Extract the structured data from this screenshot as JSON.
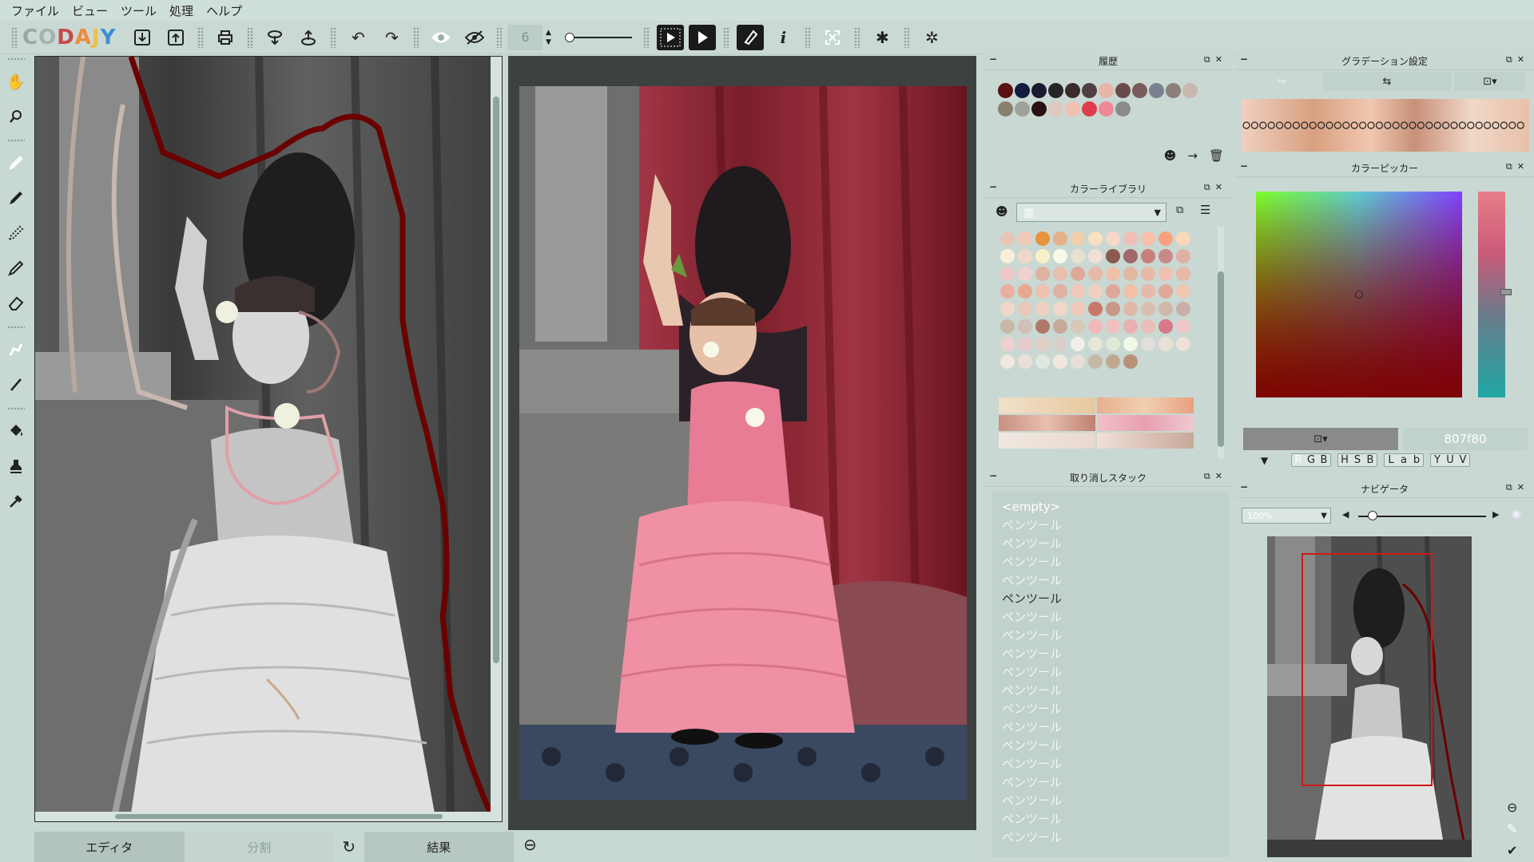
{
  "menu": [
    "ファイル",
    "ビュー",
    "ツール",
    "処理",
    "ヘルプ"
  ],
  "app": {
    "logo_letters": [
      "C",
      "O",
      "D",
      "A",
      "J",
      "Y"
    ],
    "logo_colors": [
      "#9aa6a4",
      "#a6b1af",
      "#c64a4a",
      "#ed8c3c",
      "#e8c14a",
      "#3c8fd6"
    ]
  },
  "toolbar": {
    "brush_size": "6"
  },
  "icons": {
    "import": "⇩",
    "export": "⇧",
    "print": "⎙",
    "undo": "↶",
    "redo": "↷",
    "eye": "◉",
    "info": "i",
    "star": "✱",
    "bug": "✲"
  },
  "tabs": {
    "editor": "エディタ",
    "split": "分割",
    "result": "結果"
  },
  "panels": {
    "history": {
      "title": "履歴"
    },
    "library": {
      "title": "カラーライブラリ",
      "combo_value": "茵"
    },
    "undo": {
      "title": "取り消しスタック",
      "items": [
        "<empty>",
        "ペンツール",
        "ペンツール",
        "ペンツール",
        "ペンツール",
        "ペンツール",
        "ペンツール",
        "ペンツール",
        "ペンツール",
        "ペンツール",
        "ペンツール",
        "ペンツール",
        "ペンツール",
        "ペンツール",
        "ペンツール",
        "ペンツール",
        "ペンツール",
        "ペンツール",
        "ペンツール"
      ],
      "current_index": 5
    },
    "gradient": {
      "title": "グラデーション設定"
    },
    "picker": {
      "title": "カラーピッカー",
      "hex_value": "807f80",
      "modes": [
        [
          "R",
          "G",
          "B"
        ],
        [
          "H",
          "S",
          "B"
        ],
        [
          "L",
          "a",
          "b"
        ],
        [
          "Y",
          "U",
          "V"
        ]
      ]
    },
    "navigator": {
      "title": "ナビゲータ",
      "zoom": "100%"
    }
  },
  "history_colors": [
    "#5a1010",
    "#101c40",
    "#1a1a30",
    "#262626",
    "#3a2a2a",
    "#4e4040",
    "#e8b4a8",
    "#6a4a4a",
    "#7a5a5a",
    "#7a8090",
    "#8a7f7a",
    "#c8b8b0",
    "#8a8070",
    "#a0a09a",
    "#2a1010",
    "#e0c8c0",
    "#f0c0b0",
    "#e03c4c",
    "#f08898",
    "#8a8a8a"
  ],
  "library_colors": [
    "#e8c4b4",
    "#f0c8b8",
    "#e8943c",
    "#e8b088",
    "#f0d0a8",
    "#f8e0c0",
    "#f8d8c8",
    "#f0c0b8",
    "#f8c0a8",
    "#f8a080",
    "#f8d8b8",
    "#f8f0d8",
    "#f0d8c8",
    "#f8f0c8",
    "#f8f8e8",
    "#e8e0d0",
    "#f0e0d8",
    "#8a5a50",
    "#a0686a",
    "#c88078",
    "#c88888",
    "#e0b0a8",
    "#f0c8c8",
    "#f0d0d0",
    "#e0b0a0",
    "#e8c0b0",
    "#e0a898",
    "#e8b8a8",
    "#f0c0a8",
    "#e0b8a0",
    "#e8b8a8",
    "#f0c0b0",
    "#e8b8a8",
    "#e8b0a0",
    "#e8a890",
    "#f0c0b0",
    "#e0b0a0",
    "#f0c8b8",
    "#f0d0c0",
    "#e0a898",
    "#f0c0a8",
    "#e8b8a8",
    "#e0a898",
    "#f0c8b0",
    "#f0d8c8",
    "#e8c8b8",
    "#f0d0c0",
    "#f0d8c8",
    "#f0c8b8",
    "#c87868",
    "#c89888",
    "#e0b8a8",
    "#d8c0b0",
    "#d0b8a8",
    "#c8b0a8",
    "#c8b8a8",
    "#d0c0b8",
    "#b07868",
    "#c8a898",
    "#d8c8b8",
    "#f0b8b8",
    "#f0c0c0",
    "#e8b0b0",
    "#e8c0b8",
    "#d87888",
    "#f0c8c8",
    "#f0d0d0",
    "#e8c8c8",
    "#e0d0c8",
    "#d8d0c8",
    "#f0f0e8",
    "#e8e8d8",
    "#e0e8d8",
    "#f0f8e8",
    "#e0e0d8",
    "#e8e0d8",
    "#f0e0d8",
    "#f0e8e0",
    "#e8e0d8",
    "#e0e8e0",
    "#f0e8e0",
    "#e8e0d8",
    "#c8b8a8",
    "#c0a890",
    "#b89078"
  ],
  "colors": {
    "bg": "#c8d8d2",
    "panel": "#c9d8d2",
    "accent_red": "#d01818"
  }
}
